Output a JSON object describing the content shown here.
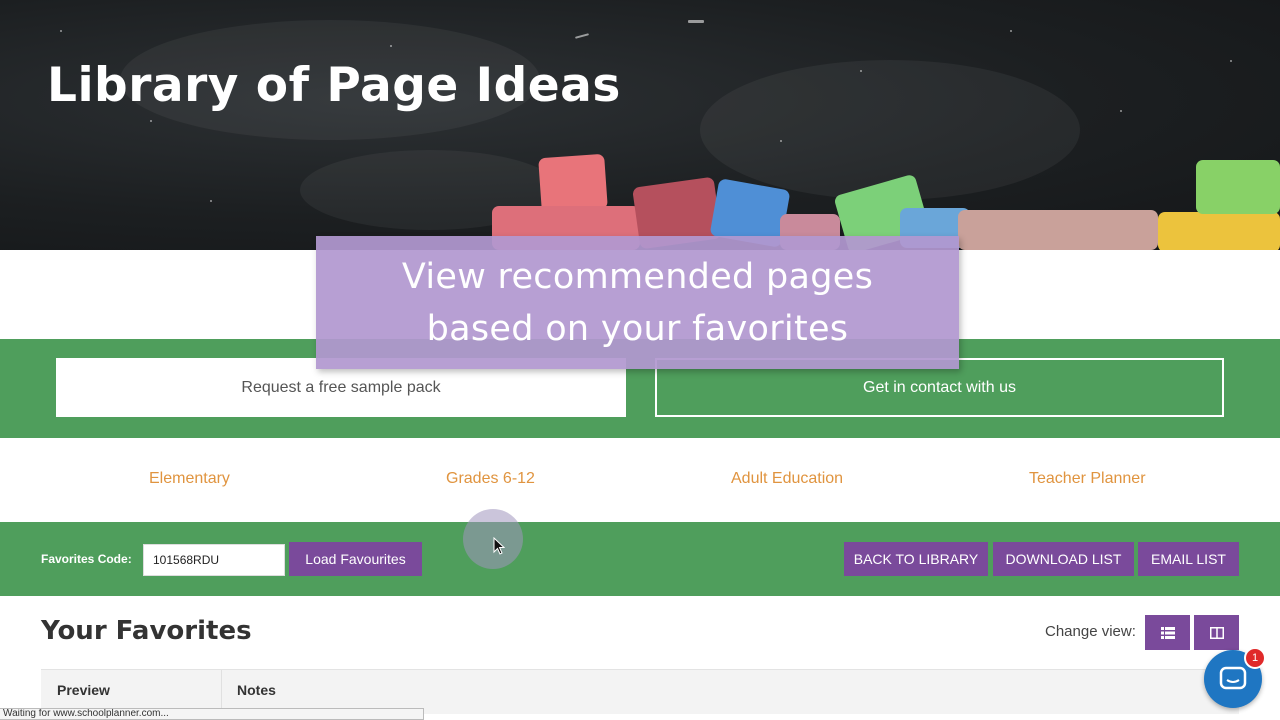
{
  "hero": {
    "title": "Library of Page Ideas"
  },
  "overlay": {
    "line1": "View recommended pages",
    "line2": "based on your favorites"
  },
  "cta": {
    "sample_pack": "Request a free sample pack",
    "contact": "Get in contact with us"
  },
  "categories": [
    "Elementary",
    "Grades 6-12",
    "Adult Education",
    "Teacher Planner"
  ],
  "favorites_bar": {
    "code_label": "Favorites Code:",
    "code_value": "101568RDU",
    "load_button": "Load Favourites",
    "back_button": "BACK TO LIBRARY",
    "download_button": "DOWNLOAD LIST",
    "email_button": "EMAIL LIST"
  },
  "favorites": {
    "title": "Your Favorites",
    "change_view_label": "Change view:",
    "columns": [
      "Preview",
      "Notes"
    ]
  },
  "status_bar": {
    "text": "Waiting for www.schoolplanner.com..."
  },
  "chat": {
    "badge_count": "1"
  },
  "colors": {
    "green": "#4f9e5c",
    "purple": "#7a4a9b",
    "orange": "#e0943f",
    "overlay": "#b298d0",
    "chat_blue": "#1f76c2"
  }
}
